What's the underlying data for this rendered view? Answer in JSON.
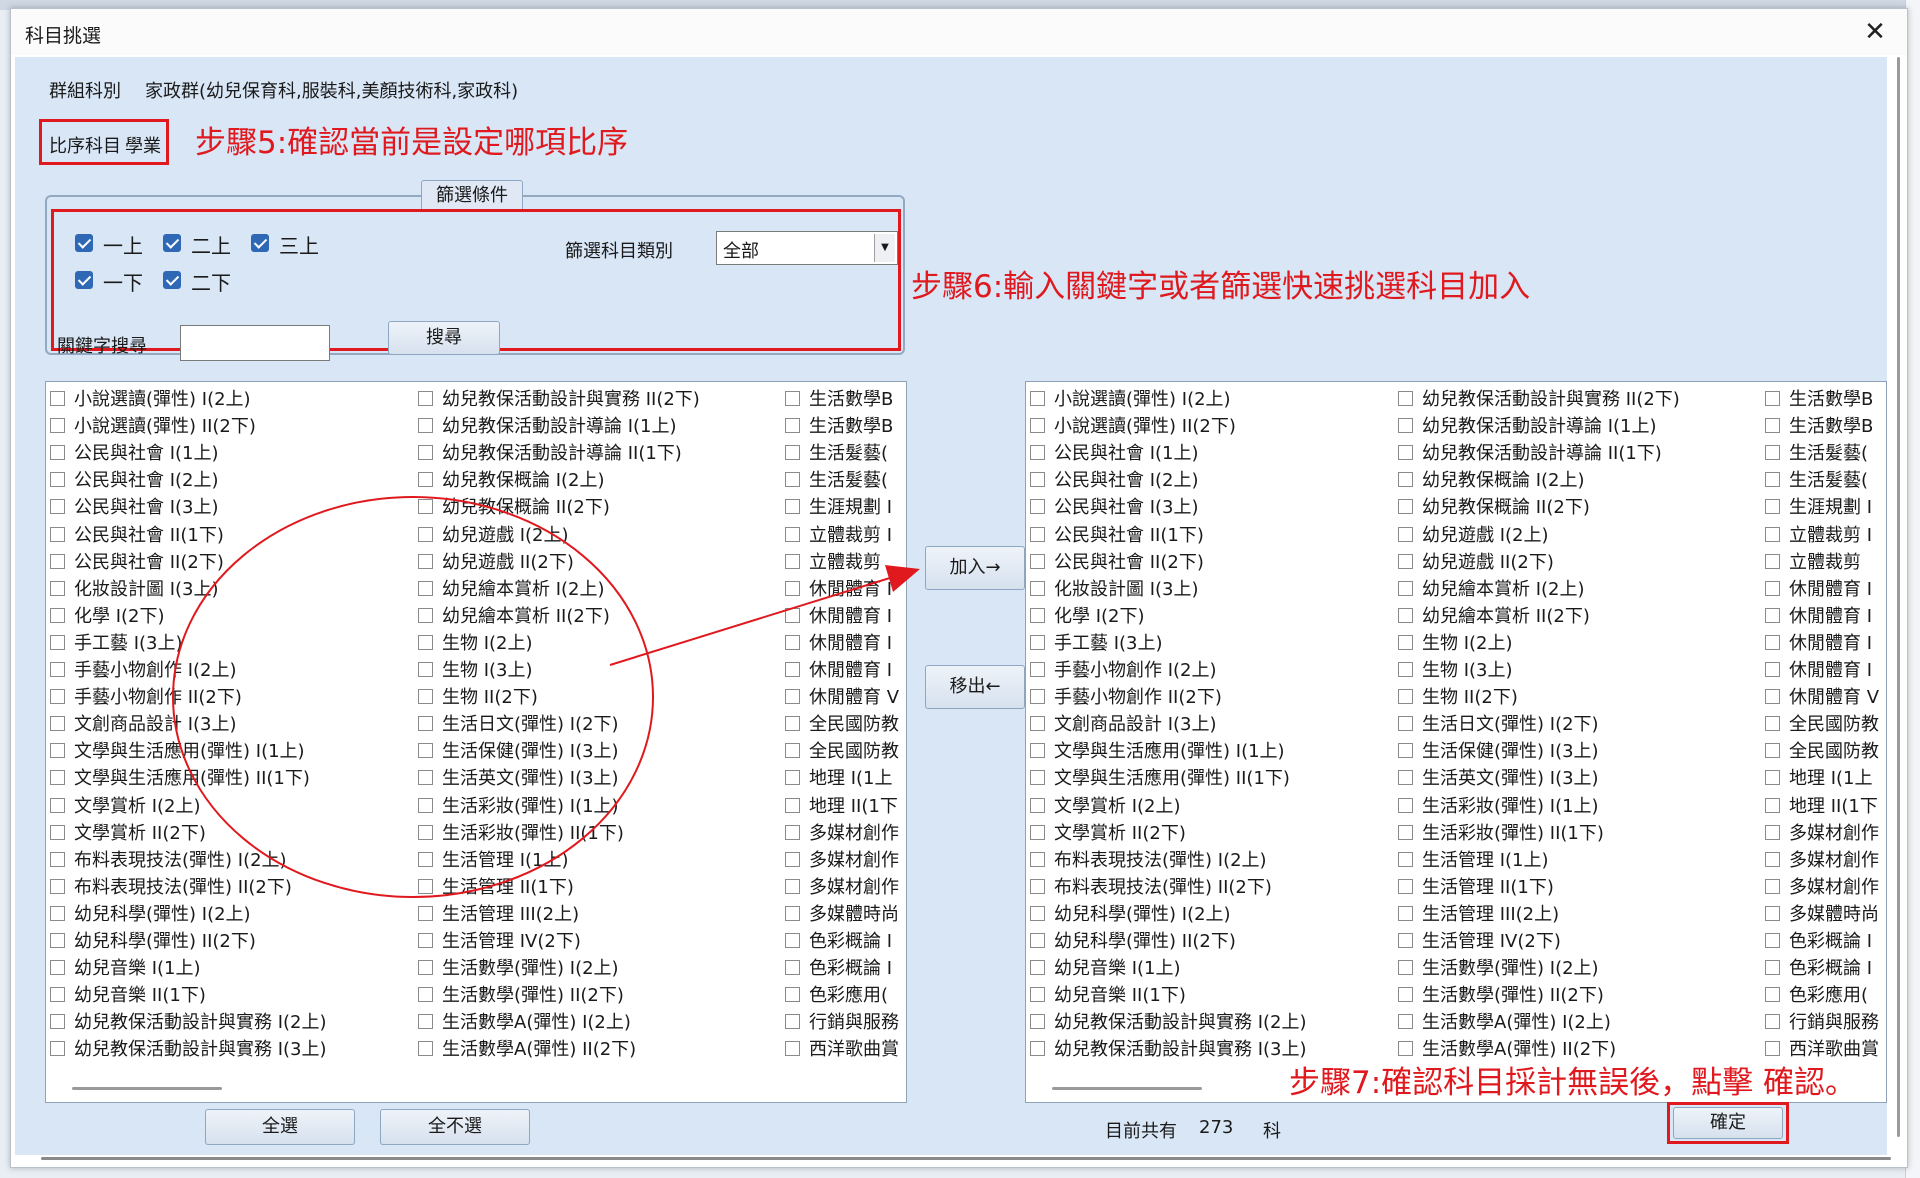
{
  "window": {
    "title": "科目挑選",
    "close_glyph": "✕"
  },
  "group": {
    "label": "群組科別",
    "value": "家政群(幼兒保育科,服裝科,美顏技術科,家政科)"
  },
  "compare": {
    "label": "比序科目",
    "value": "學業"
  },
  "filter": {
    "legend": "篩選條件",
    "terms": [
      {
        "label": "一上",
        "checked": true
      },
      {
        "label": "二上",
        "checked": true
      },
      {
        "label": "三上",
        "checked": true
      },
      {
        "label": "一下",
        "checked": true
      },
      {
        "label": "二下",
        "checked": true
      }
    ],
    "category_label": "篩選科目類別",
    "category_value": "全部",
    "keyword_label": "關鍵字搜尋",
    "keyword_value": "",
    "search_button": "搜尋"
  },
  "annotations": {
    "step5": "步驟5:確認當前是設定哪項比序",
    "step6": "步驟6:輸入關鍵字或者篩選快速挑選科目加入",
    "step7": "步驟7:確認科目採計無誤後，點擊 確認。"
  },
  "subjects": {
    "col1": [
      "小說選讀(彈性) I(2上)",
      "小說選讀(彈性) II(2下)",
      "公民與社會 I(1上)",
      "公民與社會 I(2上)",
      "公民與社會 I(3上)",
      "公民與社會 II(1下)",
      "公民與社會 II(2下)",
      "化妝設計圖 I(3上)",
      "化學 I(2下)",
      "手工藝 I(3上)",
      "手藝小物創作 I(2上)",
      "手藝小物創作 II(2下)",
      "文創商品設計 I(3上)",
      "文學與生活應用(彈性) I(1上)",
      "文學與生活應用(彈性) II(1下)",
      "文學賞析 I(2上)",
      "文學賞析 II(2下)",
      "布料表現技法(彈性) I(2上)",
      "布料表現技法(彈性) II(2下)",
      "幼兒科學(彈性) I(2上)",
      "幼兒科學(彈性) II(2下)",
      "幼兒音樂 I(1上)",
      "幼兒音樂 II(1下)",
      "幼兒教保活動設計與實務 I(2上)",
      "幼兒教保活動設計與實務 I(3上)"
    ],
    "col2": [
      "幼兒教保活動設計與實務 II(2下)",
      "幼兒教保活動設計導論 I(1上)",
      "幼兒教保活動設計導論 II(1下)",
      "幼兒教保概論 I(2上)",
      "幼兒教保概論 II(2下)",
      "幼兒遊戲 I(2上)",
      "幼兒遊戲 II(2下)",
      "幼兒繪本賞析 I(2上)",
      "幼兒繪本賞析 II(2下)",
      "生物 I(2上)",
      "生物 I(3上)",
      "生物 II(2下)",
      "生活日文(彈性) I(2下)",
      "生活保健(彈性) I(3上)",
      "生活英文(彈性) I(3上)",
      "生活彩妝(彈性) I(1上)",
      "生活彩妝(彈性) II(1下)",
      "生活管理 I(1上)",
      "生活管理 II(1下)",
      "生活管理 III(2上)",
      "生活管理 IV(2下)",
      "生活數學(彈性) I(2上)",
      "生活數學(彈性) II(2下)",
      "生活數學A(彈性) I(2上)",
      "生活數學A(彈性) II(2下)"
    ],
    "col3": [
      "生活數學B",
      "生活數學B",
      "生活髮藝(",
      "生活髮藝(",
      "生涯規劃 I",
      "立體裁剪 I",
      "立體裁剪",
      "休閒體育 I",
      "休閒體育 I",
      "休閒體育 I",
      "休閒體育 I",
      "休閒體育 V",
      "全民國防教",
      "全民國防教",
      "地理 I(1上",
      "地理 II(1下",
      "多媒材創作",
      "多媒材創作",
      "多媒材創作",
      "多媒體時尚",
      "色彩概論 I",
      "色彩概論 I",
      "色彩應用(",
      "行銷與服務",
      "西洋歌曲賞"
    ]
  },
  "buttons": {
    "add": "加入→",
    "remove": "移出←",
    "select_all": "全選",
    "deselect_all": "全不選",
    "confirm": "確定"
  },
  "status": {
    "prefix": "目前共有",
    "count": "273",
    "suffix": "科"
  }
}
